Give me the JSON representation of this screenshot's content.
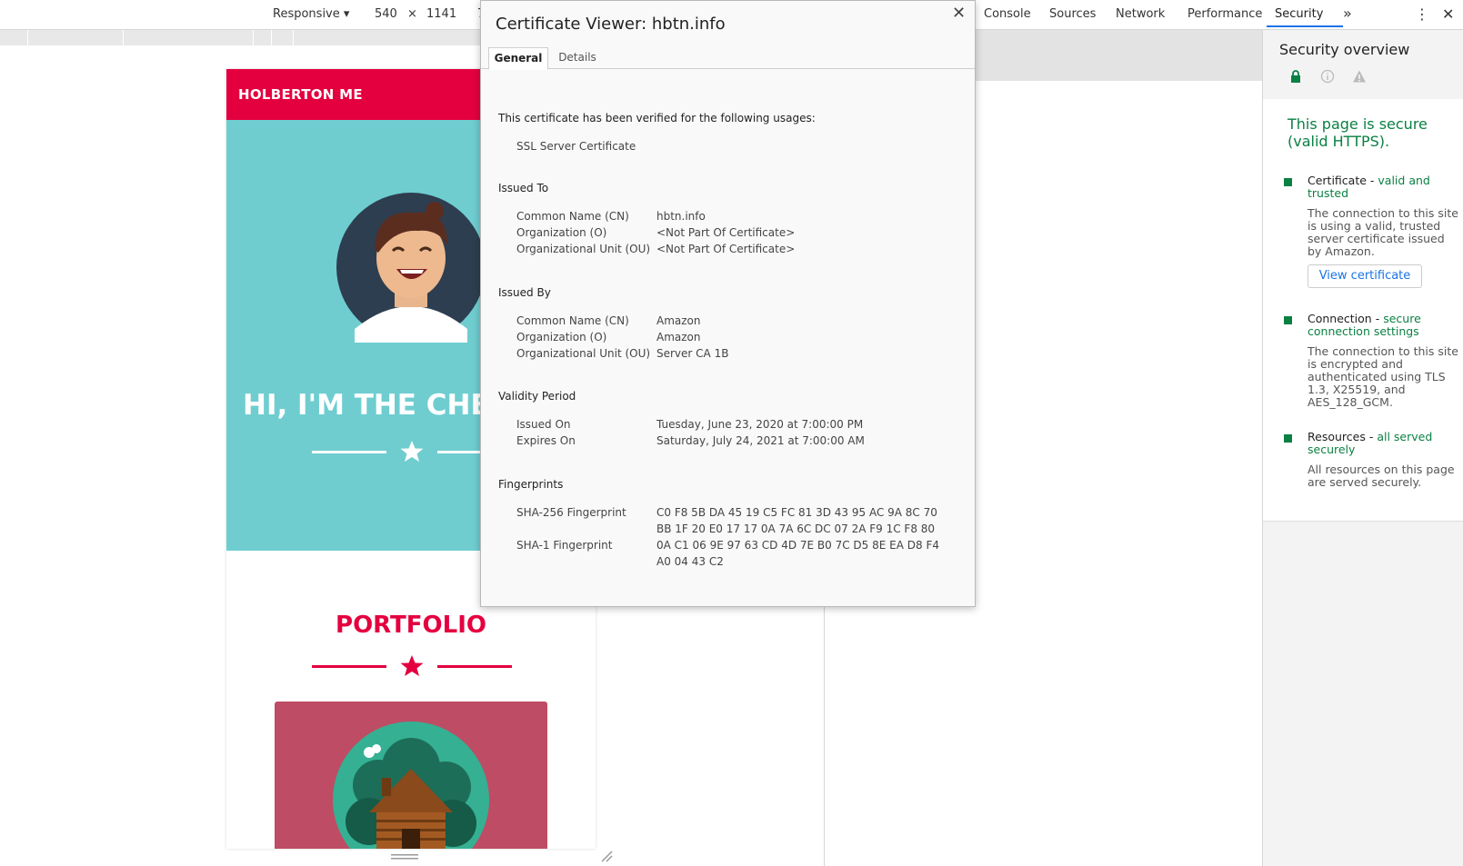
{
  "device_toolbar": {
    "mode": "Responsive",
    "width": "540",
    "times": "×",
    "height": "1141",
    "zoom_partial": "7"
  },
  "devtools_tabs": [
    "Console",
    "Sources",
    "Network",
    "Performance",
    "Security"
  ],
  "devtools_more": "»",
  "devtools_kebab": "⋮",
  "devtools_close": "✕",
  "site": {
    "brand": "HOLBERTON ME",
    "hero_title": "HI, I'M THE CHE",
    "portfolio_title": "PORTFOLIO",
    "colors": {
      "accent": "#e4003f",
      "hero_bg": "#6fcdd0",
      "card_bg": "#be4c64"
    }
  },
  "security": {
    "title": "Security overview",
    "secure_message": "This page is secure (valid HTTPS).",
    "certificate_head": "Certificate",
    "certificate_status": "valid and trusted",
    "certificate_desc": "The connection to this site is using a valid, trusted server certificate issued by Amazon.",
    "view_certificate": "View certificate",
    "connection_head": "Connection",
    "connection_status": "secure connection settings",
    "connection_desc": "The connection to this site is encrypted and authenticated using TLS 1.3, X25519, and AES_128_GCM.",
    "resources_head": "Resources",
    "resources_status": "all served securely",
    "resources_desc": "All resources on this page are served securely.",
    "dash": " - "
  },
  "cert": {
    "title": "Certificate Viewer: hbtn.info",
    "close": "✕",
    "tabs": {
      "general": "General",
      "details": "Details"
    },
    "usage_head": "This certificate has been verified for the following usages:",
    "usage": "SSL Server Certificate",
    "issued_to_head": "Issued To",
    "issued_by_head": "Issued By",
    "validity_head": "Validity Period",
    "fingerprints_head": "Fingerprints",
    "labels": {
      "cn": "Common Name (CN)",
      "o": "Organization (O)",
      "ou": "Organizational Unit (OU)",
      "issued_on": "Issued On",
      "expires_on": "Expires On",
      "sha256": "SHA-256 Fingerprint",
      "sha1": "SHA-1 Fingerprint"
    },
    "issued_to": {
      "cn": "hbtn.info",
      "o": "<Not Part Of Certificate>",
      "ou": "<Not Part Of Certificate>"
    },
    "issued_by": {
      "cn": "Amazon",
      "o": "Amazon",
      "ou": "Server CA 1B"
    },
    "validity": {
      "issued_on": "Tuesday, June 23, 2020 at 7:00:00 PM",
      "expires_on": "Saturday, July 24, 2021 at 7:00:00 AM"
    },
    "fingerprints": {
      "sha256_1": "C0 F8 5B DA 45 19 C5 FC 81 3D 43 95 AC 9A 8C 70",
      "sha256_2": "BB 1F 20 E0 17 17 0A 7A 6C DC 07 2A F9 1C F8 80",
      "sha1_1": "0A C1 06 9E 97 63 CD 4D 7E B0 7C D5 8E EA D8 F4",
      "sha1_2": "A0 04 43 C2"
    }
  }
}
